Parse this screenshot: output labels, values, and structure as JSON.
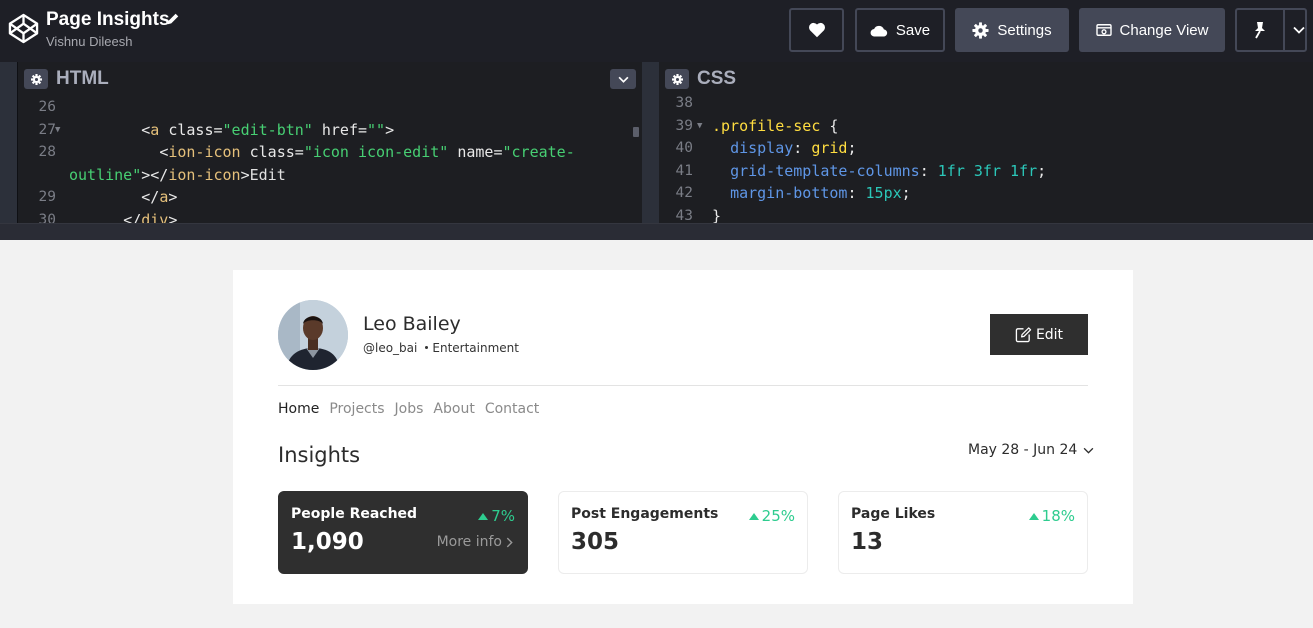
{
  "app": {
    "title": "Page Insights",
    "author": "Vishnu Dileesh",
    "buttons": {
      "save": "Save",
      "settings": "Settings",
      "change_view": "Change View"
    }
  },
  "editors": {
    "html": {
      "title": "HTML",
      "lines": [
        {
          "n": "26",
          "fold": "",
          "html": ""
        },
        {
          "n": "27",
          "fold": "▼",
          "html": "        <span class='t-punc'>&lt;</span><span class='t-tag'>a</span> <span class='t-attr'>class</span><span class='t-punc'>=</span><span class='t-str'>\"edit-btn\"</span> <span class='t-attr'>href</span><span class='t-punc'>=</span><span class='t-str'>\"\"</span><span class='t-punc'>&gt;</span>"
        },
        {
          "n": "28",
          "fold": "",
          "html": "          <span class='t-punc'>&lt;</span><span class='t-tag'>ion-icon</span> <span class='t-attr'>class</span><span class='t-punc'>=</span><span class='t-str'>\"icon icon-edit\"</span> <span class='t-attr'>name</span><span class='t-punc'>=</span><span class='t-str'>\"create-</span>"
        },
        {
          "n": "",
          "fold": "",
          "html": "<span class='t-str'>outline\"</span><span class='t-punc'>&gt;&lt;/</span><span class='t-tag'>ion-icon</span><span class='t-punc'>&gt;</span>Edit"
        },
        {
          "n": "29",
          "fold": "",
          "html": "        <span class='t-punc'>&lt;/</span><span class='t-tag'>a</span><span class='t-punc'>&gt;</span>"
        },
        {
          "n": "30",
          "fold": "",
          "html": "      <span class='t-punc'>&lt;/</span><span class='t-tag'>div</span><span class='t-punc'>&gt;</span>"
        }
      ]
    },
    "css": {
      "title": "CSS",
      "lines": [
        {
          "n": "38",
          "fold": "",
          "html": ""
        },
        {
          "n": "39",
          "fold": "▼",
          "html": "<span class='t-sel'>.profile-sec</span> <span class='t-punc'>{</span>"
        },
        {
          "n": "40",
          "fold": "",
          "html": "  <span class='t-prop'>display</span><span class='t-punc'>:</span> <span class='t-kw'>grid</span><span class='t-punc'>;</span>"
        },
        {
          "n": "41",
          "fold": "",
          "html": "  <span class='t-prop'>grid-template-columns</span><span class='t-punc'>:</span> <span class='t-num'>1fr</span> <span class='t-num'>3fr</span> <span class='t-num'>1fr</span><span class='t-punc'>;</span>"
        },
        {
          "n": "42",
          "fold": "",
          "html": "  <span class='t-prop'>margin-bottom</span><span class='t-punc'>:</span> <span class='t-num'>15px</span><span class='t-punc'>;</span>"
        },
        {
          "n": "43",
          "fold": "",
          "html": "<span class='t-punc'>}</span>"
        }
      ]
    }
  },
  "profile": {
    "name": "Leo Bailey",
    "handle": "@leo_bai",
    "category": "Entertainment",
    "edit_label": "Edit"
  },
  "nav": [
    "Home",
    "Projects",
    "Jobs",
    "About",
    "Contact"
  ],
  "insights": {
    "title": "Insights",
    "date_range": "May 28 - Jun 24",
    "more_info": "More info",
    "stats": [
      {
        "label": "People Reached",
        "value": "1,090",
        "change": "7%"
      },
      {
        "label": "Post Engagements",
        "value": "305",
        "change": "25%"
      },
      {
        "label": "Page Likes",
        "value": "13",
        "change": "18%"
      }
    ]
  },
  "colors": {
    "topbar": "#1e1f26",
    "accent_green": "#2ecc8f",
    "dark_card": "#2f2f2f"
  }
}
